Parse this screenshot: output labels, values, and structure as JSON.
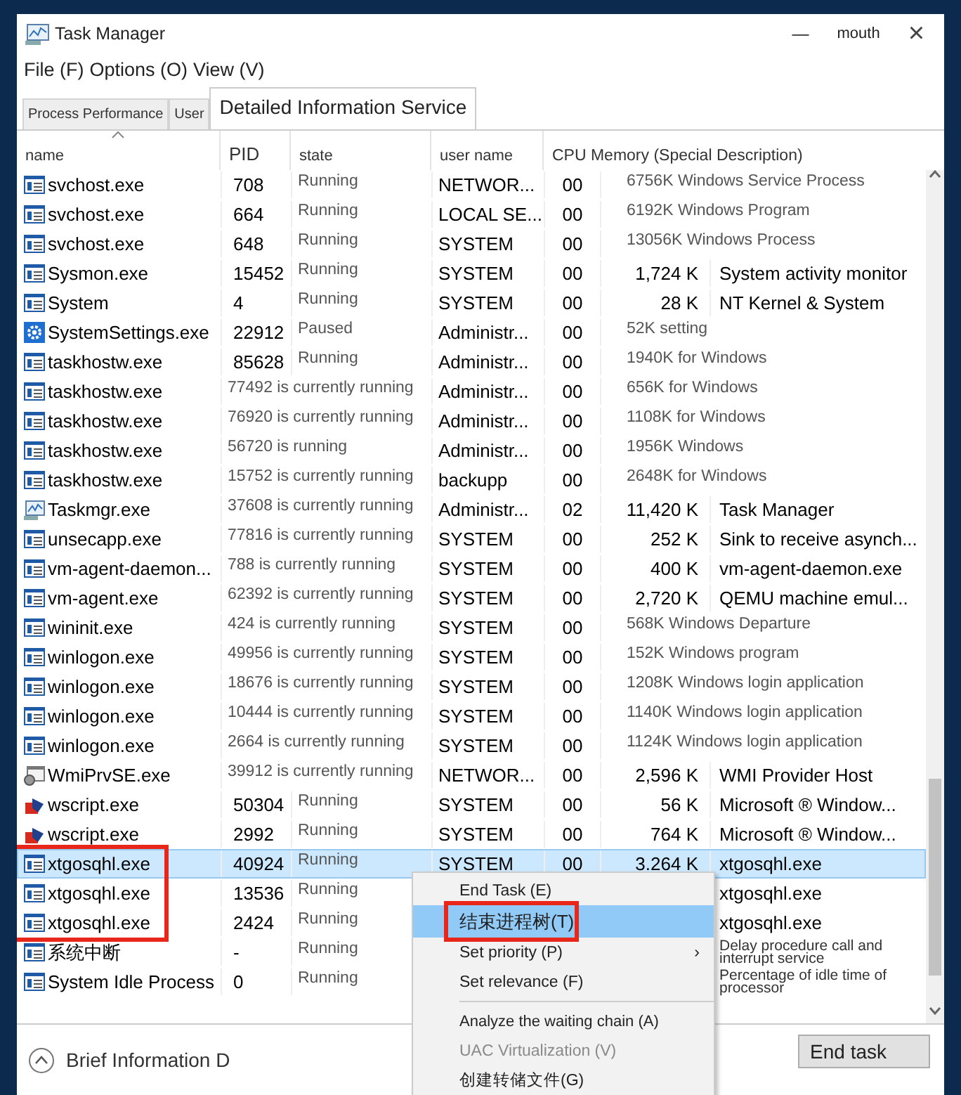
{
  "window": {
    "title": "Task Manager",
    "minimize": "—",
    "maximize": "mouth",
    "close": "×"
  },
  "menu_bar": [
    "File (F)",
    "Options (O)",
    "View (V)"
  ],
  "tabs": [
    {
      "label": "Process Performance",
      "selected": false
    },
    {
      "label": "User",
      "selected": false
    },
    {
      "label": "Detailed Information Service",
      "selected": true
    }
  ],
  "table": {
    "columns": [
      {
        "label": "name",
        "sorted": true
      },
      {
        "label": "PID",
        "sorted": false
      },
      {
        "label": "state",
        "sorted": false
      },
      {
        "label": "user name",
        "sorted": false
      },
      {
        "label": "CPU Memory (Special Description)",
        "sorted": false
      }
    ],
    "rows": [
      {
        "kind": "app",
        "name": "svchost.exe",
        "pid": "708",
        "state": "Running",
        "user": "NETWOR...",
        "cpu": "00",
        "memory_description": "6756K Windows Service Process",
        "selected": false,
        "outlined": false
      },
      {
        "kind": "app",
        "name": "svchost.exe",
        "pid": "664",
        "state": "Running",
        "user": "LOCAL SE...",
        "cpu": "00",
        "memory_description": "6192K Windows Program",
        "selected": false,
        "outlined": false
      },
      {
        "kind": "app",
        "name": "svchost.exe",
        "pid": "648",
        "state": "Running",
        "user": "SYSTEM",
        "cpu": "00",
        "memory_description": "13056K Windows Process",
        "selected": false,
        "outlined": false
      },
      {
        "kind": "app",
        "name": "Sysmon.exe",
        "pid": "15452",
        "state": "Running",
        "user": "SYSTEM",
        "cpu": "00",
        "memory": "1,724 K",
        "description": "System activity monitor",
        "selected": false,
        "outlined": false
      },
      {
        "kind": "app",
        "name": "System",
        "pid": "4",
        "state": "Running",
        "user": "SYSTEM",
        "cpu": "00",
        "memory": "28 K",
        "description": "NT Kernel & System",
        "selected": false,
        "outlined": false
      },
      {
        "kind": "gear",
        "name": "SystemSettings.exe",
        "pid": "22912",
        "state": "Paused",
        "user": "Administr...",
        "cpu": "00",
        "memory_description": "52K setting",
        "selected": false,
        "outlined": false
      },
      {
        "kind": "app",
        "name": "taskhostw.exe",
        "pid": "85628",
        "state": "Running",
        "user": "Administr...",
        "cpu": "00",
        "memory_description": "1940K for Windows",
        "selected": false,
        "outlined": false
      },
      {
        "kind": "app",
        "name": "taskhostw.exe",
        "pid_state": "77492 is currently running",
        "user": "Administr...",
        "cpu": "00",
        "memory_description": "656K for Windows",
        "selected": false,
        "outlined": false
      },
      {
        "kind": "app",
        "name": "taskhostw.exe",
        "pid_state": "76920 is currently running",
        "user": "Administr...",
        "cpu": "00",
        "memory_description": "1108K for Windows",
        "selected": false,
        "outlined": false
      },
      {
        "kind": "app",
        "name": "taskhostw.exe",
        "pid_state": "56720 is running",
        "user": "Administr...",
        "cpu": "00",
        "memory_description": "1956K Windows",
        "selected": false,
        "outlined": false
      },
      {
        "kind": "app",
        "name": "taskhostw.exe",
        "pid_state": "15752 is currently running",
        "user": "backupp",
        "cpu": "00",
        "memory_description": "2648K for Windows",
        "selected": false,
        "outlined": false
      },
      {
        "kind": "monitor",
        "name": "Taskmgr.exe",
        "pid_state": "37608 is currently running",
        "user": "Administr...",
        "cpu": "02",
        "memory": "11,420 K",
        "description": "Task Manager",
        "selected": false,
        "outlined": false
      },
      {
        "kind": "app",
        "name": "unsecapp.exe",
        "pid_state": "77816 is currently running",
        "user": "SYSTEM",
        "cpu": "00",
        "memory": "252 K",
        "description": "Sink to receive asynch...",
        "selected": false,
        "outlined": false
      },
      {
        "kind": "app",
        "name": "vm-agent-daemon...",
        "pid_state": "788 is currently running",
        "user": "SYSTEM",
        "cpu": "00",
        "memory": "400 K",
        "description": "vm-agent-daemon.exe",
        "selected": false,
        "outlined": false
      },
      {
        "kind": "app",
        "name": "vm-agent.exe",
        "pid_state": "62392 is currently running",
        "user": "SYSTEM",
        "cpu": "00",
        "memory": "2,720 K",
        "description": "QEMU machine emul...",
        "selected": false,
        "outlined": false
      },
      {
        "kind": "app",
        "name": "wininit.exe",
        "pid_state": "424 is currently running",
        "user": "SYSTEM",
        "cpu": "00",
        "memory_description": "568K Windows Departure",
        "selected": false,
        "outlined": false
      },
      {
        "kind": "app",
        "name": "winlogon.exe",
        "pid_state": "49956 is currently running",
        "user": "SYSTEM",
        "cpu": "00",
        "memory_description": "152K Windows program",
        "selected": false,
        "outlined": false
      },
      {
        "kind": "app",
        "name": "winlogon.exe",
        "pid_state": "18676 is currently running",
        "user": "SYSTEM",
        "cpu": "00",
        "memory_description": "1208K Windows login application",
        "selected": false,
        "outlined": false
      },
      {
        "kind": "app",
        "name": "winlogon.exe",
        "pid_state": "10444 is currently running",
        "user": "SYSTEM",
        "cpu": "00",
        "memory_description": "1140K Windows login application",
        "selected": false,
        "outlined": false
      },
      {
        "kind": "app",
        "name": "winlogon.exe",
        "pid_state": "2664 is currently running",
        "user": "SYSTEM",
        "cpu": "00",
        "memory_description": "1124K Windows login application",
        "selected": false,
        "outlined": false
      },
      {
        "kind": "service",
        "name": "WmiPrvSE.exe",
        "pid_state": "39912 is currently running",
        "user": "NETWOR...",
        "cpu": "00",
        "memory": "2,596 K",
        "description": "WMI Provider Host",
        "selected": false,
        "outlined": false
      },
      {
        "kind": "script",
        "name": "wscript.exe",
        "pid": "50304",
        "state": "Running",
        "user": "SYSTEM",
        "cpu": "00",
        "memory": "56 K",
        "description": "Microsoft ® Window...",
        "selected": false,
        "outlined": false
      },
      {
        "kind": "script",
        "name": "wscript.exe",
        "pid": "2992",
        "state": "Running",
        "user": "SYSTEM",
        "cpu": "00",
        "memory": "764 K",
        "description": "Microsoft ® Window...",
        "selected": false,
        "outlined": false
      },
      {
        "kind": "app",
        "name": "xtgosqhl.exe",
        "pid": "40924",
        "state": "Running",
        "user": "SYSTEM",
        "cpu": "00",
        "memory": "3.264 K",
        "description": "xtgosqhl.exe",
        "selected": true,
        "outlined": true
      },
      {
        "kind": "app",
        "name": "xtgosqhl.exe",
        "pid": "13536",
        "state": "Running",
        "description": "xtgosqhl.exe",
        "selected": false,
        "outlined": true
      },
      {
        "kind": "app",
        "name": "xtgosqhl.exe",
        "pid": "2424",
        "state": "Running",
        "description": "xtgosqhl.exe",
        "selected": false,
        "outlined": true
      },
      {
        "kind": "app",
        "name": "系统中断",
        "pid": "-",
        "state": "Running",
        "description": "Delay procedure call and interrupt service",
        "selected": false,
        "outlined": false
      },
      {
        "kind": "app",
        "name": "System Idle Process",
        "pid": "0",
        "state": "Running",
        "description": "Percentage of idle time of processor",
        "selected": false,
        "outlined": false
      }
    ]
  },
  "context_menu": [
    {
      "kind": "item",
      "label": "End Task (E)",
      "selected": false,
      "outlined": false,
      "disabled": false
    },
    {
      "kind": "item",
      "label": "结束进程树(T)",
      "selected": true,
      "outlined": true,
      "disabled": false
    },
    {
      "kind": "submenu",
      "label": "Set priority (P)",
      "arrow": "›",
      "selected": false,
      "outlined": false,
      "disabled": false
    },
    {
      "kind": "item",
      "label": "Set relevance (F)",
      "selected": false,
      "outlined": false,
      "disabled": false
    },
    {
      "kind": "separator"
    },
    {
      "kind": "item",
      "label": "Analyze the waiting chain (A)",
      "selected": false,
      "outlined": false,
      "disabled": false
    },
    {
      "kind": "item",
      "label": "UAC Virtualization (V)",
      "selected": false,
      "outlined": false,
      "disabled": true
    },
    {
      "kind": "item",
      "label": "创建转储文件(G)",
      "selected": false,
      "outlined": false,
      "disabled": false
    }
  ],
  "footer": {
    "details_toggle": "Brief Information D",
    "end_task_button": "End task"
  }
}
